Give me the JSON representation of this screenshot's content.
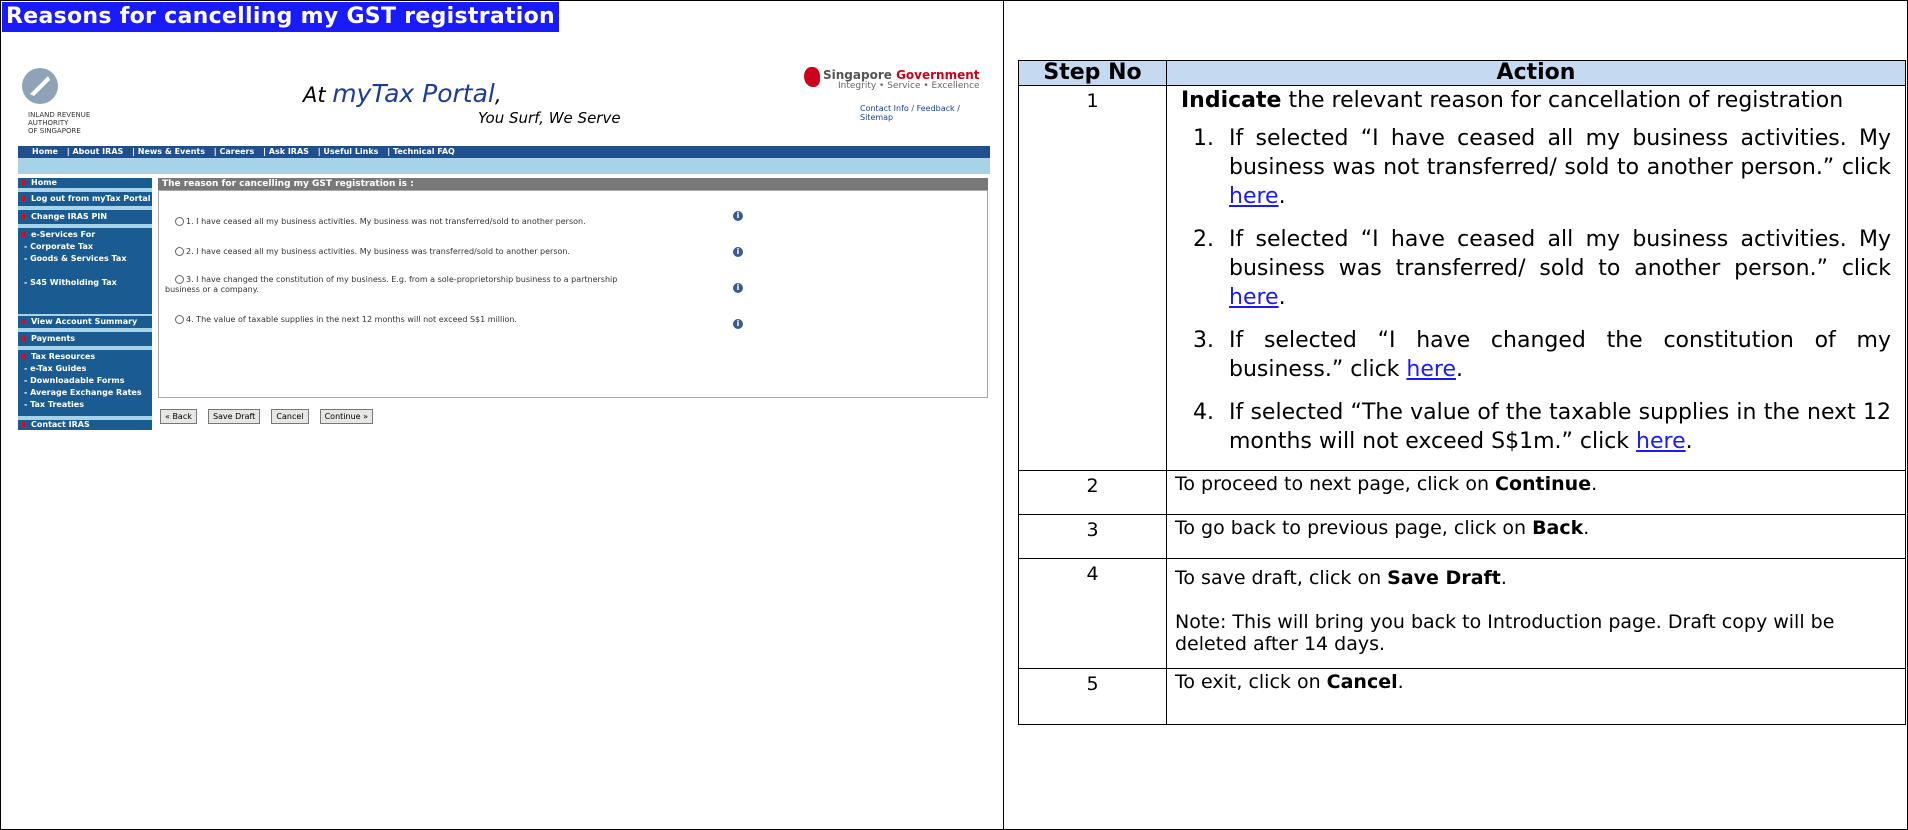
{
  "title": "Reasons for cancelling my GST registration",
  "screenshot": {
    "iras_text": [
      "INLAND REVENUE",
      "AUTHORITY",
      "OF SINGAPORE"
    ],
    "portal_title_prefix": "At ",
    "portal_title_main": "myTax Portal",
    "portal_title_suffix": ",",
    "tagline": "You Surf, We Serve",
    "sg_gov_word1": "Singapore ",
    "sg_gov_word2": "Government",
    "sg_gov_sub": "Integrity • Service • Excellence",
    "contact_links": "Contact Info / Feedback / Sitemap",
    "nav_items": [
      "Home",
      "| About IRAS",
      "| News & Events",
      "| Careers",
      "| Ask IRAS",
      "| Useful Links",
      "| Technical FAQ"
    ],
    "sidebar": {
      "home": "Home",
      "logout": "Log out from myTax Portal",
      "change_pin": "Change IRAS PIN",
      "eservices": "e-Services For",
      "corporate": "- Corporate Tax",
      "gst": "- Goods & Services Tax",
      "s45": "- S45 Witholding Tax",
      "account": "View Account Summary",
      "payments": "Payments",
      "resources": "Tax Resources",
      "guides": "- e-Tax Guides",
      "forms": "- Downloadable Forms",
      "rates": "- Average Exchange Rates",
      "treaties": "- Tax Treaties",
      "contact": "Contact IRAS"
    },
    "reason_header": "The reason for cancelling my GST registration is :",
    "options": [
      "1. I have ceased all my business activities. My business was not transferred/sold to another person.",
      "2. I have ceased all my business activities. My business was transferred/sold to another person.",
      "3. I have changed the constitution of my business. E.g. from a sole-proprietorship business to a partnership",
      "business or a company.",
      "4. The value of taxable supplies in the next 12 months will not exceed S$1 million."
    ],
    "info_glyph": "i",
    "buttons": [
      "« Back",
      "Save Draft",
      "Cancel",
      "Continue »"
    ]
  },
  "table": {
    "headers": [
      "Step No",
      "Action"
    ],
    "step1": {
      "num": "1",
      "indicate_bold": "Indicate",
      "indicate_rest": " the relevant reason for cancellation of registration",
      "items": [
        "If selected “I have ceased all my business activities. My business was not transferred/ sold to another person.” click ",
        "If selected “I have ceased all my business activities. My business was transferred/ sold to another person.” click ",
        "If selected “I have changed the constitution of my business.” click ",
        "If selected “The value of the taxable supplies in the next 12 months will not exceed S$1m.” click "
      ],
      "link": "here",
      "period": "."
    },
    "step2": {
      "num": "2",
      "pre": "To proceed to next page, click on ",
      "bold": "Continue",
      "post": "."
    },
    "step3": {
      "num": "3",
      "pre": "To go back to previous page, click on ",
      "bold": "Back",
      "post": "."
    },
    "step4": {
      "num": "4",
      "pre": "To save draft, click on ",
      "bold": "Save Draft",
      "post": ".",
      "note": "Note: This will bring you back to Introduction page. Draft copy will be deleted after 14 days."
    },
    "step5": {
      "num": "5",
      "pre": "To exit, click on ",
      "bold": "Cancel",
      "post": "."
    }
  }
}
